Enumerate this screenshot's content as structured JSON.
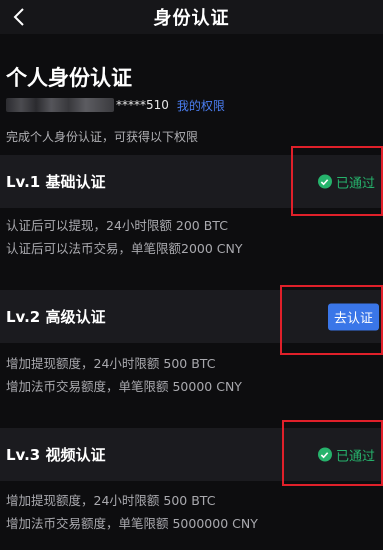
{
  "header": {
    "title": "身份认证"
  },
  "page": {
    "title": "个人身份认证",
    "masked_id_suffix": "*****510",
    "rights_link": "我的权限",
    "subtitle": "完成个人身份认证，可获得以下权限"
  },
  "levels": [
    {
      "title": "Lv.1 基础认证",
      "status": "已通过",
      "lines": [
        "认证后可以提现，24小时限额 200 BTC",
        "认证后可以法币交易，单笔限额2000 CNY"
      ]
    },
    {
      "title": "Lv.2 高级认证",
      "action": "去认证",
      "lines": [
        "增加提现额度，24小时限额 500 BTC",
        "增加法币交易额度，单笔限额 50000 CNY"
      ]
    },
    {
      "title": "Lv.3 视频认证",
      "status": "已通过",
      "lines": [
        "增加提现额度，24小时限额 500 BTC",
        "增加法币交易额度，单笔限额 5000000 CNY"
      ]
    }
  ],
  "colors": {
    "accent_blue": "#3a76e8",
    "passed_green": "#26b36c",
    "highlight_red": "#e0202a"
  }
}
